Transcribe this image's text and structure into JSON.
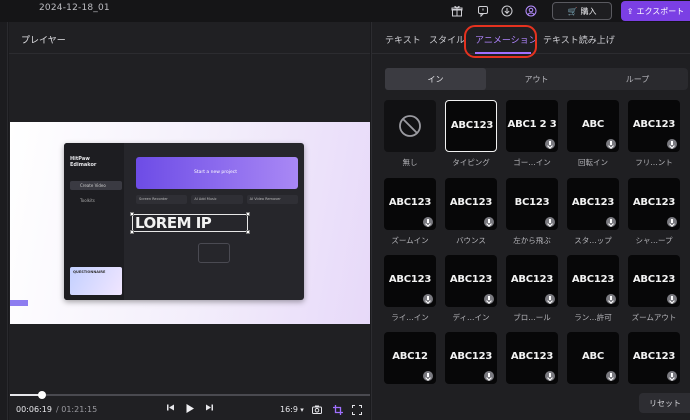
{
  "topbar": {
    "project_name": "2024-12-18_01",
    "buy_label": "購入",
    "export_label": "エクスポート",
    "icons": [
      "gift-icon",
      "feedback-icon",
      "download-icon",
      "account-icon"
    ]
  },
  "player": {
    "title": "プレイヤー",
    "current_time": "00:06:19",
    "total_time": "/ 01:21:15",
    "aspect_ratio": "16:9",
    "progress": 0.09,
    "preview": {
      "app_name_line1": "HitPaw",
      "app_name_line2": "Edimakor",
      "nav_create": "Create Video",
      "nav_project": "Toolkits",
      "banner_text": "Start a new project",
      "tools": [
        "Screen Recorder",
        "AI Add Music",
        "AI Video Remover"
      ],
      "overlay_text": "LOREM IP",
      "card_title": "QUESTIONNAIRE"
    }
  },
  "panel": {
    "tabs": [
      "テキスト",
      "スタイル",
      "アニメーション",
      "テキスト読み上げ"
    ],
    "active_tab": 2,
    "segments": [
      "イン",
      "アウト",
      "ループ"
    ],
    "active_segment": 0,
    "animations": [
      {
        "label": "無し",
        "preview": ""
      },
      {
        "label": "タイピング",
        "preview": "ABC123"
      },
      {
        "label": "ゴー…イン",
        "preview": "ABC1 2 3"
      },
      {
        "label": "回転イン",
        "preview": "ABC"
      },
      {
        "label": "フリ…ント",
        "preview": "ABC123"
      },
      {
        "label": "ズームイン",
        "preview": "ABC123"
      },
      {
        "label": "バウンス",
        "preview": "ABC123"
      },
      {
        "label": "左から飛ぶ",
        "preview": "BC123"
      },
      {
        "label": "スタ…ップ",
        "preview": "ABC123"
      },
      {
        "label": "シャ…ープ",
        "preview": "ABC123"
      },
      {
        "label": "ライ…イン",
        "preview": "ABC123"
      },
      {
        "label": "ディ…イン",
        "preview": "ABC123"
      },
      {
        "label": "ブロ…ール",
        "preview": "ABC123"
      },
      {
        "label": "ラン…許可",
        "preview": "ABC123"
      },
      {
        "label": "ズームアウト",
        "preview": "ABC123"
      },
      {
        "label": "",
        "preview": "ABC12"
      },
      {
        "label": "",
        "preview": "ABC123"
      },
      {
        "label": "",
        "preview": "ABC123"
      },
      {
        "label": "",
        "preview": "ABC"
      },
      {
        "label": "",
        "preview": "ABC123"
      }
    ],
    "reset_label": "リセット"
  },
  "colors": {
    "accent": "#7b3fe4",
    "active_tab": "#b185ff",
    "highlight_ring": "#e5321f",
    "background": "#1a1a1d"
  }
}
